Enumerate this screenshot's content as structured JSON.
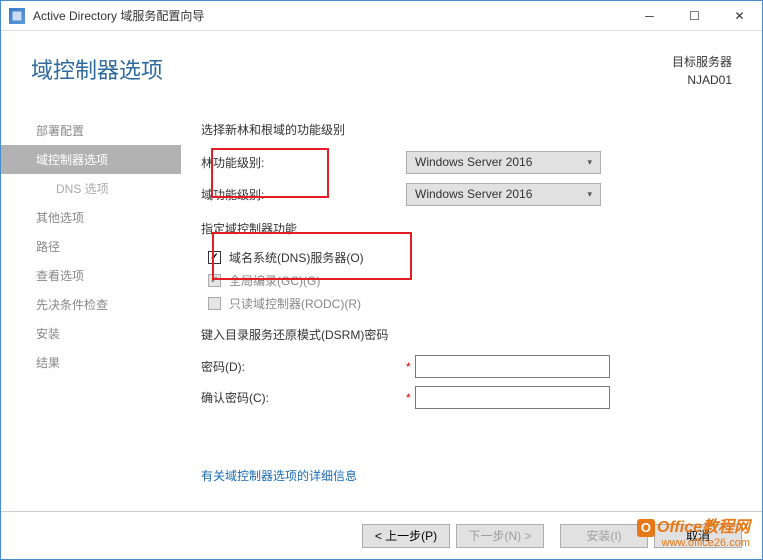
{
  "window": {
    "title": "Active Directory 域服务配置向导"
  },
  "header": {
    "page_title": "域控制器选项",
    "target_label": "目标服务器",
    "target_server": "NJAD01"
  },
  "sidebar": {
    "items": [
      {
        "label": "部署配置"
      },
      {
        "label": "域控制器选项"
      },
      {
        "label": "DNS 选项"
      },
      {
        "label": "其他选项"
      },
      {
        "label": "路径"
      },
      {
        "label": "查看选项"
      },
      {
        "label": "先决条件检查"
      },
      {
        "label": "安装"
      },
      {
        "label": "结果"
      }
    ]
  },
  "main": {
    "section1_title": "选择新林和根域的功能级别",
    "forest_level_label": "林功能级别:",
    "domain_level_label": "域功能级别:",
    "forest_level_value": "Windows Server 2016",
    "domain_level_value": "Windows Server 2016",
    "section2_title": "指定域控制器功能",
    "cb_dns": "域名系统(DNS)服务器(O)",
    "cb_gc": "全局编录(GC)(G)",
    "cb_rodc": "只读域控制器(RODC)(R)",
    "section3_title": "键入目录服务还原模式(DSRM)密码",
    "pwd_label": "密码(D):",
    "confirm_label": "确认密码(C):",
    "more_link": "有关域控制器选项的详细信息"
  },
  "footer": {
    "prev": "< 上一步(P)",
    "next": "下一步(N) >",
    "install": "安装(I)",
    "cancel": "取消"
  },
  "watermark": {
    "title": "Office教程网",
    "url": "www.office26.com"
  }
}
